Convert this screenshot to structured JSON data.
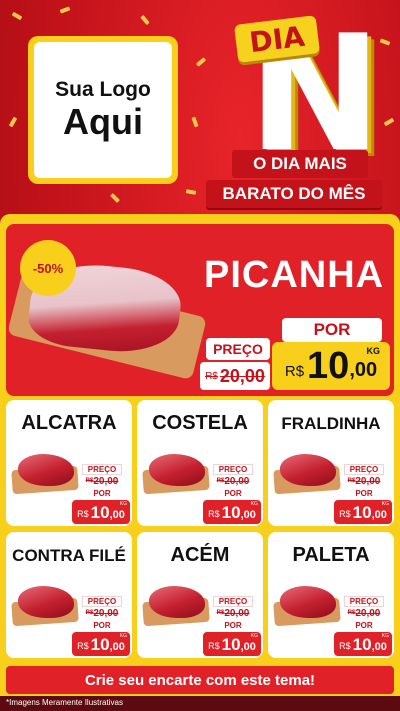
{
  "logo": {
    "line1": "Sua Logo",
    "line2": "Aqui"
  },
  "brand": {
    "dia": "DIA",
    "letter": "N",
    "sub1": "O DIA MAIS",
    "sub2": "BARATO DO MÊS"
  },
  "hero": {
    "discount": "-50%",
    "product": "PICANHA",
    "preco_label": "PREÇO",
    "old_currency": "R$",
    "old_int": "20",
    "old_dec": ",00",
    "por_label": "POR",
    "new_currency": "R$",
    "new_int": "10",
    "new_dec": ",00",
    "unit": "KG"
  },
  "products": [
    {
      "name": "ALCATRA",
      "preco_label": "PREÇO",
      "old_currency": "R$",
      "old_int": "20",
      "old_dec": ",00",
      "por_label": "POR",
      "currency": "R$",
      "int": "10",
      "dec": ",00",
      "unit": "KG"
    },
    {
      "name": "COSTELA",
      "preco_label": "PREÇO",
      "old_currency": "R$",
      "old_int": "20",
      "old_dec": ",00",
      "por_label": "POR",
      "currency": "R$",
      "int": "10",
      "dec": ",00",
      "unit": "KG"
    },
    {
      "name": "FRALDINHA",
      "preco_label": "PREÇO",
      "old_currency": "R$",
      "old_int": "20",
      "old_dec": ",00",
      "por_label": "POR",
      "currency": "R$",
      "int": "10",
      "dec": ",00",
      "unit": "KG"
    },
    {
      "name": "CONTRA FILÉ",
      "preco_label": "PREÇO",
      "old_currency": "R$",
      "old_int": "20",
      "old_dec": ",00",
      "por_label": "POR",
      "currency": "R$",
      "int": "10",
      "dec": ",00",
      "unit": "KG"
    },
    {
      "name": "ACÉM",
      "preco_label": "PREÇO",
      "old_currency": "R$",
      "old_int": "20",
      "old_dec": ",00",
      "por_label": "POR",
      "currency": "R$",
      "int": "10",
      "dec": ",00",
      "unit": "KG"
    },
    {
      "name": "PALETA",
      "preco_label": "PREÇO",
      "old_currency": "R$",
      "old_int": "20",
      "old_dec": ",00",
      "por_label": "POR",
      "currency": "R$",
      "int": "10",
      "dec": ",00",
      "unit": "KG"
    }
  ],
  "cta": "Crie seu encarte com este tema!",
  "disclaimer": "*Imagens Meramente Ilustrativas",
  "colors": {
    "red": "#e02128",
    "dark_red": "#c3121a",
    "yellow": "#f8cf1a",
    "white": "#ffffff"
  }
}
